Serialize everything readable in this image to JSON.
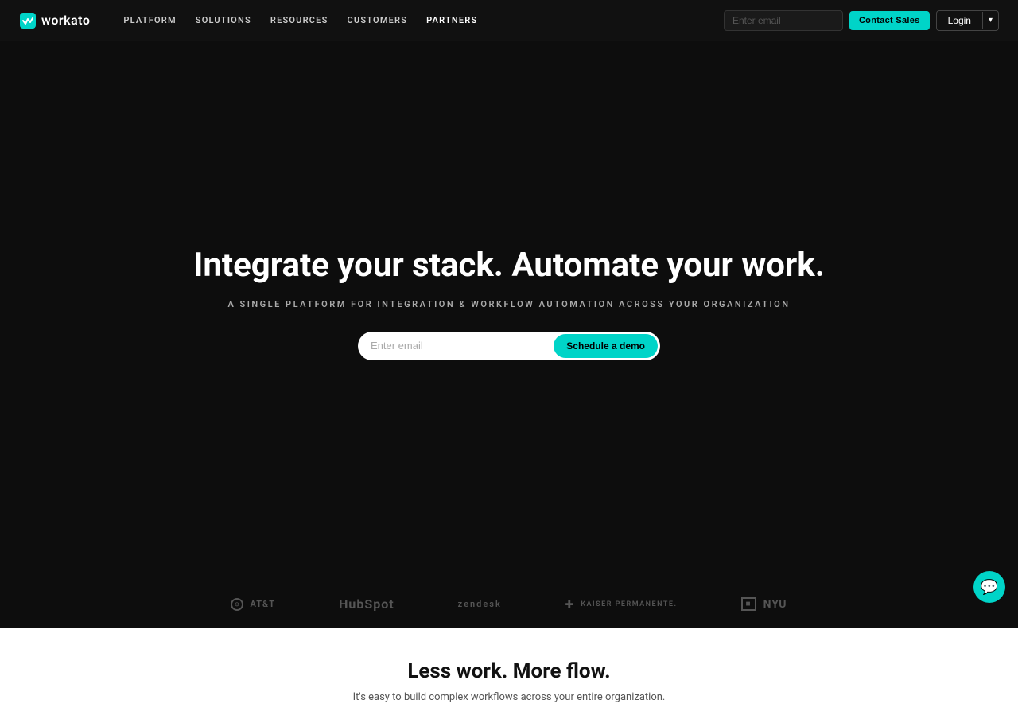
{
  "navbar": {
    "logo_text": "workato",
    "nav_links": [
      {
        "label": "PLATFORM",
        "id": "platform"
      },
      {
        "label": "SOLUTIONS",
        "id": "solutions"
      },
      {
        "label": "RESOURCES",
        "id": "resources"
      },
      {
        "label": "CUSTOMERS",
        "id": "customers"
      },
      {
        "label": "PARTNERS",
        "id": "partners"
      }
    ],
    "email_placeholder": "Enter email",
    "contact_sales_label": "Contact Sales",
    "login_label": "Login",
    "login_dropdown_icon": "▾"
  },
  "hero": {
    "title": "Integrate your stack. Automate your work.",
    "subtitle": "A SINGLE PLATFORM FOR INTEGRATION & WORKFLOW AUTOMATION ACROSS YOUR ORGANIZATION",
    "email_placeholder": "Enter email",
    "demo_button_label": "Schedule a demo"
  },
  "logos": [
    {
      "id": "att",
      "label": "AT&T",
      "type": "att"
    },
    {
      "id": "hubspot",
      "label": "HubSpot",
      "type": "hubspot"
    },
    {
      "id": "zendesk",
      "label": "zendesk",
      "type": "zendesk"
    },
    {
      "id": "kaiser",
      "label": "KAISER PERMANENTE.",
      "type": "kaiser"
    },
    {
      "id": "nyu",
      "label": "NYU",
      "type": "nyu"
    }
  ],
  "bottom": {
    "title": "Less work. More flow.",
    "subtitle": "It's easy to build complex workflows across your entire organization."
  },
  "chat": {
    "icon": "💬"
  },
  "colors": {
    "accent": "#00d4c8",
    "bg_dark": "#0d0d0d",
    "bg_light": "#fff"
  }
}
